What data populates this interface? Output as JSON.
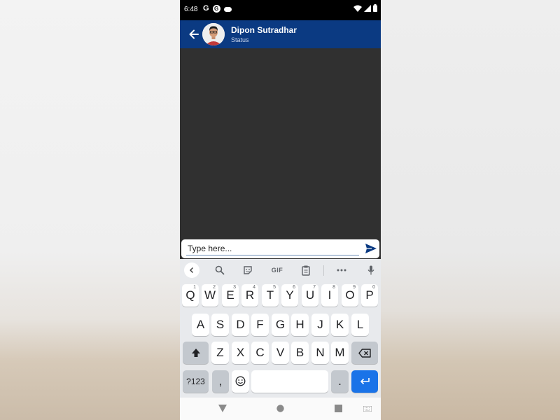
{
  "status_bar": {
    "time": "6:48",
    "notification_icons": [
      "google-icon",
      "circle-g-icon",
      "cloud-icon"
    ],
    "system_icons": [
      "wifi-icon",
      "signal-icon",
      "battery-icon"
    ]
  },
  "header": {
    "contact_name": "Dipon Sutradhar",
    "contact_status": "Status",
    "back_icon": "back-arrow-icon",
    "avatar": "avatar"
  },
  "composer": {
    "placeholder": "Type here...",
    "value": "",
    "send_icon": "send-icon"
  },
  "keyboard": {
    "toolbar": {
      "gif_label": "GIF",
      "icons": [
        "chevron-left-icon",
        "search-icon",
        "sticker-icon",
        "gif-icon",
        "clipboard-icon",
        "more-icon",
        "mic-icon"
      ]
    },
    "row1": [
      {
        "letter": "Q",
        "hint": "1"
      },
      {
        "letter": "W",
        "hint": "2"
      },
      {
        "letter": "E",
        "hint": "3"
      },
      {
        "letter": "R",
        "hint": "4"
      },
      {
        "letter": "T",
        "hint": "5"
      },
      {
        "letter": "Y",
        "hint": "6"
      },
      {
        "letter": "U",
        "hint": "7"
      },
      {
        "letter": "I",
        "hint": "8"
      },
      {
        "letter": "O",
        "hint": "9"
      },
      {
        "letter": "P",
        "hint": "0"
      }
    ],
    "row2": [
      "A",
      "S",
      "D",
      "F",
      "G",
      "H",
      "J",
      "K",
      "L"
    ],
    "row3": [
      "Z",
      "X",
      "C",
      "V",
      "B",
      "N",
      "M"
    ],
    "symbols_label": "?123",
    "comma_label": ",",
    "period_label": "."
  },
  "nav_bar": {
    "icons": [
      "back-triangle-icon",
      "home-circle-icon",
      "recents-square-icon",
      "keyboard-switch-icon"
    ]
  },
  "colors": {
    "app_bar": "#0b3a82",
    "chat_background": "#303030",
    "send_accent": "#0b3a82",
    "enter_key": "#1a73e8"
  }
}
